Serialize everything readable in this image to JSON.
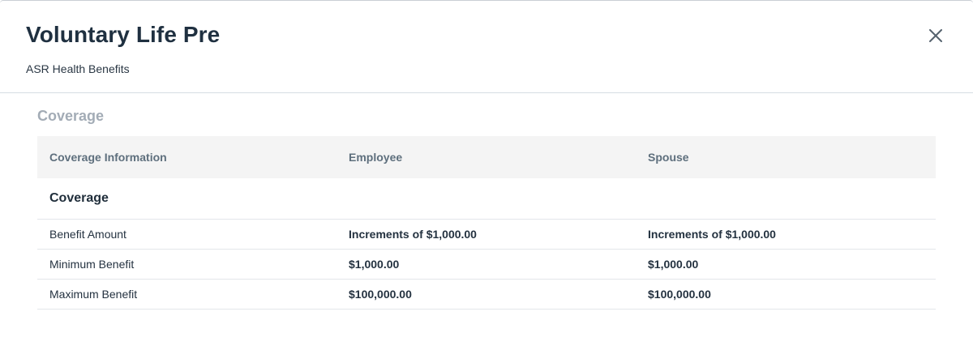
{
  "header": {
    "title": "Voluntary Life Pre",
    "subtitle": "ASR Health Benefits",
    "close_icon": "close-icon"
  },
  "section": {
    "title": "Coverage"
  },
  "table": {
    "columns": [
      "Coverage Information",
      "Employee",
      "Spouse"
    ],
    "group_label": "Coverage",
    "rows": [
      {
        "label": "Benefit Amount",
        "employee": "Increments of $1,000.00",
        "spouse": "Increments of $1,000.00"
      },
      {
        "label": "Minimum Benefit",
        "employee": "$1,000.00",
        "spouse": "$1,000.00"
      },
      {
        "label": "Maximum Benefit",
        "employee": "$100,000.00",
        "spouse": "$100,000.00"
      }
    ]
  },
  "colors": {
    "title": "#1f3040",
    "section_title": "#a3acb6",
    "header_bg": "#f4f4f4"
  }
}
